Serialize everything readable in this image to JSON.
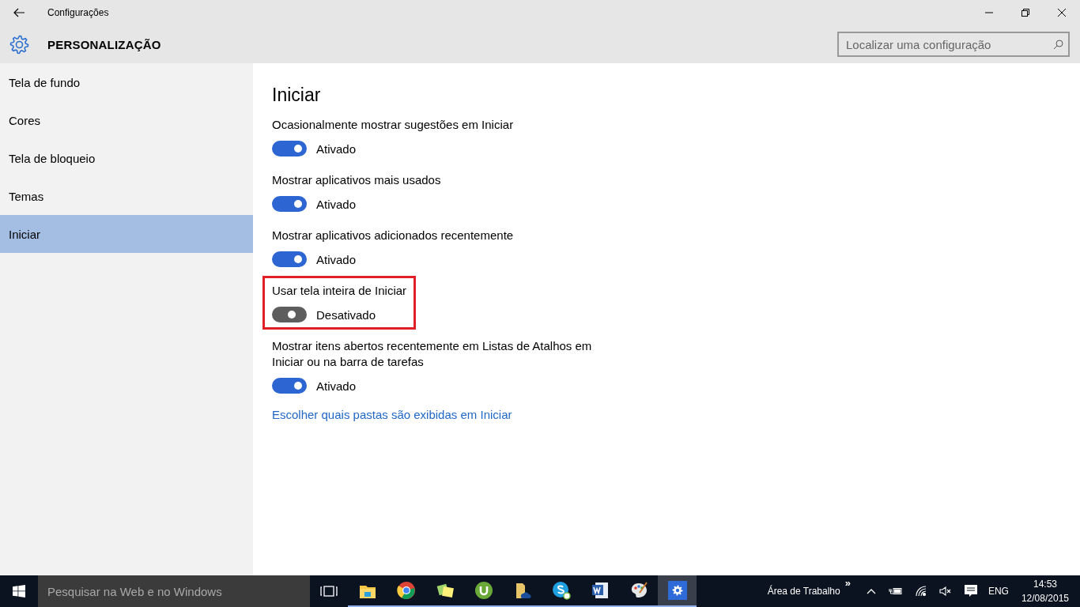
{
  "window": {
    "title": "Configurações"
  },
  "header": {
    "title": "PERSONALIZAÇÃO",
    "search": {
      "placeholder": "Localizar uma configuração"
    }
  },
  "sidebar": {
    "items": [
      {
        "label": "Tela de fundo",
        "selected": false
      },
      {
        "label": "Cores",
        "selected": false
      },
      {
        "label": "Tela de bloqueio",
        "selected": false
      },
      {
        "label": "Temas",
        "selected": false
      },
      {
        "label": "Iniciar",
        "selected": true
      }
    ]
  },
  "content": {
    "title": "Iniciar",
    "settings": [
      {
        "label": "Ocasionalmente mostrar sugestões em Iniciar",
        "on": true,
        "state": "Ativado",
        "highlighted": false
      },
      {
        "label": "Mostrar aplicativos mais usados",
        "on": true,
        "state": "Ativado",
        "highlighted": false
      },
      {
        "label": "Mostrar aplicativos adicionados recentemente",
        "on": true,
        "state": "Ativado",
        "highlighted": false
      },
      {
        "label": "Usar tela inteira de Iniciar",
        "on": false,
        "state": "Desativado",
        "highlighted": true
      },
      {
        "label": "Mostrar itens abertos recentemente em Listas de Atalhos em Iniciar ou na barra de tarefas",
        "on": true,
        "state": "Ativado",
        "highlighted": false
      }
    ],
    "link": "Escolher quais pastas são exibidas em Iniciar"
  },
  "taskbar": {
    "search": {
      "placeholder": "Pesquisar na Web e no Windows"
    },
    "apps": [
      {
        "kind": "folder",
        "running": true,
        "active": false
      },
      {
        "kind": "browser",
        "running": true,
        "active": false
      },
      {
        "kind": "notes",
        "running": true,
        "active": false
      },
      {
        "kind": "torrent",
        "running": true,
        "active": false
      },
      {
        "kind": "cloudfolder",
        "running": true,
        "active": false
      },
      {
        "kind": "chat",
        "running": true,
        "active": false
      },
      {
        "kind": "document",
        "running": true,
        "active": false
      },
      {
        "kind": "palette",
        "running": true,
        "active": false
      },
      {
        "kind": "settings",
        "running": true,
        "active": true
      }
    ],
    "toolbar": "Área de Trabalho",
    "toolbar_more": "»",
    "language": "ENG",
    "time": "14:53",
    "date": "12/08/2015"
  }
}
